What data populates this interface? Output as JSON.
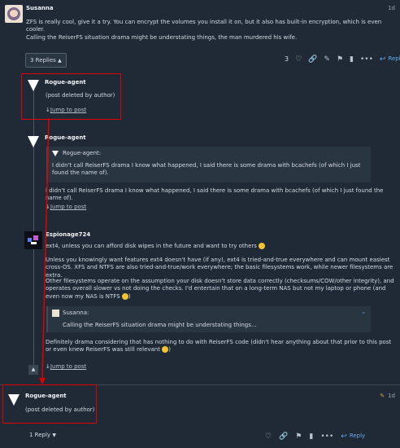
{
  "post_susanna": {
    "author": "Susanna",
    "age": "1d",
    "p1": "ZFS is really cool, give it a try. You can encrypt the volumes you install it on, but it also has built-in encryption, which is even cooler.",
    "p2": "Calling the ReiserFS situation drama might be understating things, the man murdered his wife.",
    "replies_button": "3 Replies",
    "like_count": "3",
    "reply_label": "Reply"
  },
  "reply1": {
    "author": "Rogue-agent",
    "body": "(post deleted by author)",
    "jump": "Jump to post"
  },
  "reply2": {
    "author": "Rogue-agent",
    "quote_author": "Rogue-agent:",
    "quote_text": "I didn't call ReiserFS drama I know what happened, I said there is some drama with bcachefs (of which I just found the name of).",
    "body": "I didn't call ReiserFS drama I know what happened, I said there is some drama with bcachefs (of which I just found the name of).",
    "jump": "Jump to post"
  },
  "reply3": {
    "author": "Espionage724",
    "p1": "ext4, unless you can afford disk wipes in the future and want to try others",
    "p2": "Unless you knowingly want features ext4 doesn't have (if any), ext4 is tried-and-true everywhere and can mount easiest cross-OS. XFS and NTFS are also tried-and-true/work everywhere; the basic filesystems work, while newer filesystems are extra.",
    "p3": "Other filesystems operate on the assumption your disk doesn't store data correctly (checksums/COW/other integrity), and operates overall slower vs not doing the checks. I'd entertain that on a long-term NAS but not my laptop or phone (and even now my NAS is NTFS",
    "p3_end": ")",
    "quote_author": "Susanna:",
    "quote_text": "Calling the ReiserFS situation drama might be understating things…",
    "p4": "Definitely drama considering that has nothing to do with ReiserFS code (didn't hear anything about that prior to this post or even knew ReiserFS was still relevant",
    "p4_end": ")",
    "jump": "Jump to post"
  },
  "post_bottom": {
    "author": "Rogue-agent",
    "body": "(post deleted by author)",
    "age": "1d",
    "replies_button": "1 Reply",
    "reply_label": "Reply"
  },
  "colors": {
    "background": "#1f2a36",
    "annotation_red": "#e00000",
    "text": "#d4dbe3"
  }
}
